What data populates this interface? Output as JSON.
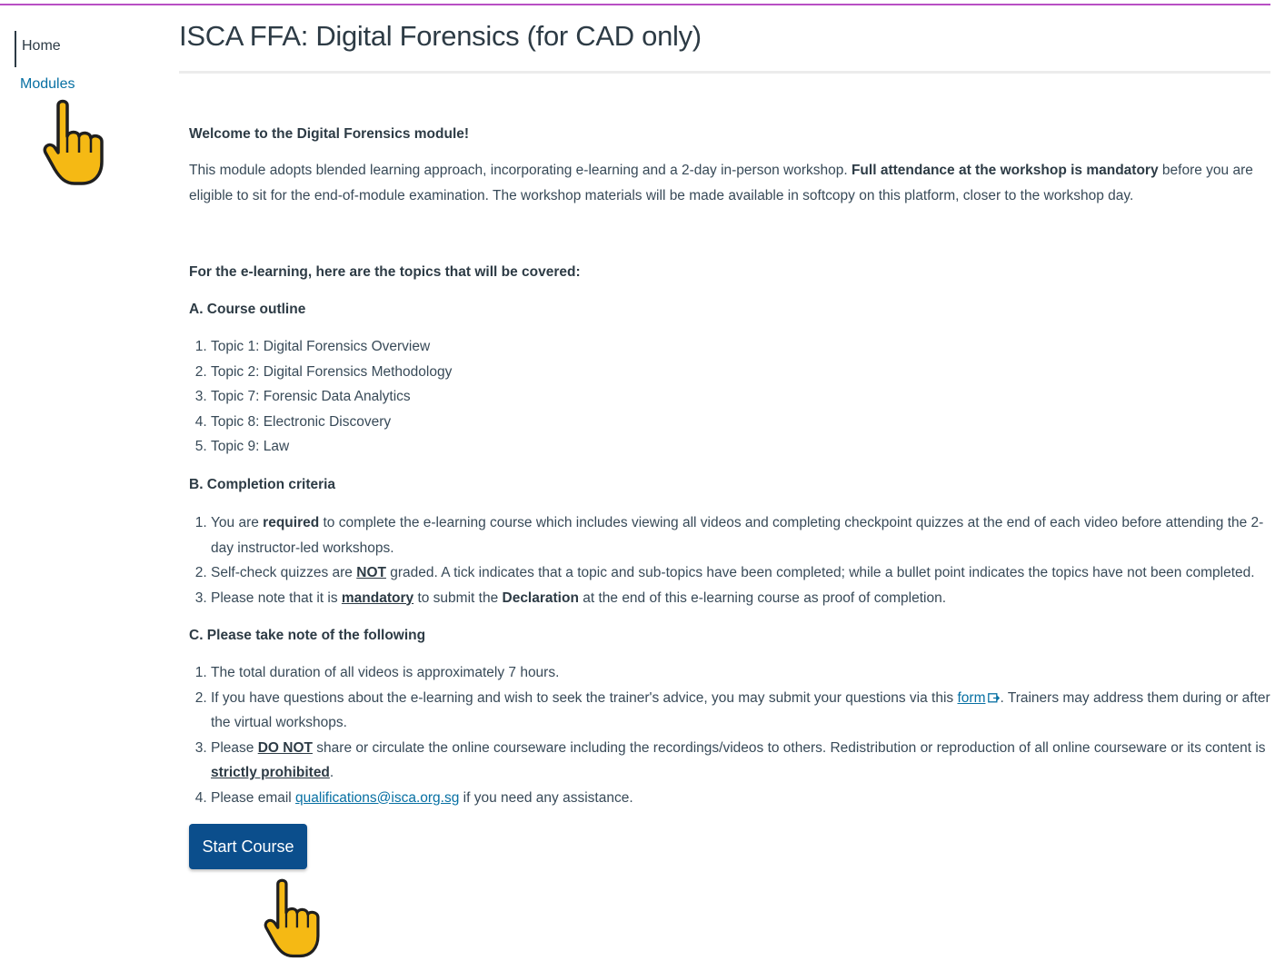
{
  "colors": {
    "accent_border": "#b84fc4",
    "link": "#0770a3",
    "button_bg": "#0b4e8c",
    "hand_fill": "#f5b914"
  },
  "sidebar": {
    "items": [
      {
        "label": "Home",
        "active": true
      },
      {
        "label": "Modules",
        "active": false
      }
    ]
  },
  "page": {
    "title": "ISCA FFA: Digital Forensics (for CAD only)"
  },
  "content": {
    "welcome": "Welcome to the Digital Forensics module!",
    "intro_part1": "This module adopts blended learning approach, incorporating e-learning and a 2-day in-person workshop. ",
    "intro_bold": "Full attendance at the workshop is mandatory",
    "intro_part2": " before you are eligible to sit for the end-of-module examination. The workshop materials will be made available in softcopy on this platform, closer to the workshop day.",
    "elearn_heading": "For the e-learning, here are the topics that will be covered:",
    "outline_heading": "A. Course outline",
    "outline_items": [
      "Topic 1: Digital Forensics Overview",
      "Topic 2: Digital Forensics Methodology",
      "Topic 7: Forensic Data Analytics",
      "Topic 8: Electronic Discovery",
      "Topic 9: Law"
    ],
    "criteria_heading": "B. Completion criteria",
    "criteria": {
      "c1_a": "You are ",
      "c1_bold": "required",
      "c1_b": " to complete the e-learning course which includes viewing all videos and completing checkpoint quizzes at the end of each video before attending the 2-day instructor-led workshops.",
      "c2_a": "Self-check quizzes are ",
      "c2_ub": "NOT",
      "c2_b": " graded. A tick indicates that a topic and sub-topics have been completed; while a bullet point indicates the topics have not been completed.",
      "c3_a": "Please note that it is ",
      "c3_ub": "mandatory",
      "c3_b": " to submit the ",
      "c3_bold": "Declaration",
      "c3_c": " at the end of this e-learning course as proof of completion."
    },
    "notes_heading": "C. Please take note of the following",
    "notes": {
      "n1": "The total duration of all videos is approximately 7 hours.",
      "n2_a": "If you have questions about the e-learning and wish to seek the trainer's advice, you may submit your questions via this ",
      "n2_link": "form",
      "n2_b": ". Trainers may address them during or after the virtual workshops.",
      "n3_a": "Please ",
      "n3_ub": "DO NOT",
      "n3_b": " share or circulate the online courseware including the recordings/videos to others. Redistribution or reproduction of all online courseware or its content is ",
      "n3_ub2": "strictly prohibited",
      "n3_c": ".",
      "n4_a": "Please email ",
      "n4_link": "qualifications@isca.org.sg",
      "n4_b": " if you need any assistance."
    }
  },
  "button": {
    "start_label": "Start Course"
  },
  "icons": {
    "pointer": "hand-pointer-icon",
    "external": "external-link-icon"
  }
}
